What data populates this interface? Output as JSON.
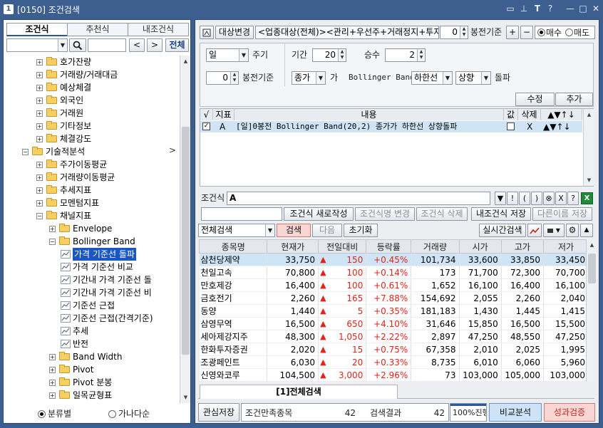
{
  "window": {
    "badge": "1",
    "title": "[0150] 조건검색"
  },
  "left": {
    "tabs": [
      "조건식",
      "추천식",
      "내조건식"
    ],
    "search": {
      "nav_prev": "<",
      "nav_next": ">",
      "all_button": "전체"
    },
    "tree": [
      {
        "label": "호가잔량",
        "level": 1,
        "toggle": "+"
      },
      {
        "label": "거래량/거래대금",
        "level": 1,
        "toggle": "+"
      },
      {
        "label": "예상체결",
        "level": 1,
        "toggle": "+"
      },
      {
        "label": "외국인",
        "level": 1,
        "toggle": "+"
      },
      {
        "label": "거래원",
        "level": 1,
        "toggle": "+"
      },
      {
        "label": "기타정보",
        "level": 1,
        "toggle": "+"
      },
      {
        "label": "체결강도",
        "level": 1,
        "toggle": "+"
      },
      {
        "label": "기술적분석",
        "level": 0,
        "toggle": "−"
      },
      {
        "label": "주가이동평균",
        "level": 1,
        "toggle": "+"
      },
      {
        "label": "거래량이동평균",
        "level": 1,
        "toggle": "+"
      },
      {
        "label": "추세지표",
        "level": 1,
        "toggle": "+"
      },
      {
        "label": "모멘텀지표",
        "level": 1,
        "toggle": "+"
      },
      {
        "label": "채널지표",
        "level": 1,
        "toggle": "−"
      },
      {
        "label": "Envelope",
        "level": 2,
        "toggle": "+"
      },
      {
        "label": "Bollinger Band",
        "level": 2,
        "toggle": "−"
      },
      {
        "label": "가격 기준선 돌파",
        "level": 3,
        "leaf": true,
        "selected": true
      },
      {
        "label": "가격 기준선 비교",
        "level": 3,
        "leaf": true
      },
      {
        "label": "기간내 가격 기준선 돌",
        "level": 3,
        "leaf": true
      },
      {
        "label": "기간내 가격 기준선 비",
        "level": 3,
        "leaf": true
      },
      {
        "label": "기준선 근접",
        "level": 3,
        "leaf": true
      },
      {
        "label": "기준선 근접(간격기준)",
        "level": 3,
        "leaf": true
      },
      {
        "label": "추세",
        "level": 3,
        "leaf": true
      },
      {
        "label": "반전",
        "level": 3,
        "leaf": true
      },
      {
        "label": "Band Width",
        "level": 2,
        "toggle": "+"
      },
      {
        "label": "Pivot",
        "level": 2,
        "toggle": "+"
      },
      {
        "label": "Pivot 분봉",
        "level": 2,
        "toggle": "+"
      },
      {
        "label": "일목균형표",
        "level": 2,
        "toggle": "+"
      }
    ],
    "tree_expander_arrow": ">",
    "radios": {
      "by_category": "분류별",
      "alphabetical": "가나다순"
    }
  },
  "right": {
    "target_button": "대상변경",
    "universe_text": "<업종대상(전체)><관리+우선주+거래정지+투자",
    "bar_offset": "0",
    "bar_basis_label": "봉전기준",
    "plus": "+",
    "minus": "−",
    "buy_label": "매수",
    "sell_label": "매도",
    "params": {
      "period_type": "일",
      "period_type_label": "주기",
      "range_label": "기간",
      "range_value": "20",
      "mult_label": "승수",
      "mult_value": "2",
      "bar_offset": "0",
      "bar_basis_label": "봉전기준",
      "price_field": "종가",
      "particle": "가",
      "indicator_label": "Bollinger Band",
      "line": "하한선",
      "direction": "상향",
      "action": "돌파"
    },
    "edit_button": "수정",
    "add_button": "추가",
    "cond_table": {
      "headers": [
        "√",
        "지표",
        "내용",
        "값",
        "삭제",
        "▲▼↑↓"
      ],
      "rows": [
        {
          "checked": true,
          "id": "A",
          "content": "[일]0봉전 Bollinger Band(20,2) 종가가 하한선 상향돌파",
          "delete": "X",
          "arrows": "▲▼↑↓"
        }
      ]
    },
    "formula": {
      "label": "조건식",
      "value": "A",
      "buttons": [
        "▼",
        "!",
        "(",
        ")",
        "⊗",
        "X",
        "?"
      ]
    },
    "actions": {
      "new_button": "조건식 새로작성",
      "rename_button": "조건식명 변경",
      "delete_button": "조건식 삭제",
      "save_button": "내조건식 저장",
      "save_as_button": "다른이름 저장"
    },
    "searchbar": {
      "scope": "전체검색",
      "search_button": "검색",
      "next_button": "다음",
      "reset_button": "초기화",
      "realtime_button": "실시간검색"
    },
    "grid": {
      "headers": [
        "종목명",
        "현재가",
        "전일대비",
        "등락률",
        "거래량",
        "시가",
        "고가",
        "저가"
      ],
      "rows": [
        {
          "name": "삼천당제약",
          "price": "33,750",
          "change": "150",
          "rate": "+0.45%",
          "volume": "101,734",
          "open": "33,600",
          "high": "33,850",
          "low": "33,450",
          "highlight": true
        },
        {
          "name": "천일고속",
          "price": "70,800",
          "change": "100",
          "rate": "+0.14%",
          "volume": "173",
          "open": "71,700",
          "high": "72,300",
          "low": "70,700"
        },
        {
          "name": "만호제강",
          "price": "16,400",
          "change": "100",
          "rate": "+0.61%",
          "volume": "1,652",
          "open": "16,100",
          "high": "16,400",
          "low": "16,100"
        },
        {
          "name": "금호전기",
          "price": "2,260",
          "change": "165",
          "rate": "+7.88%",
          "volume": "154,692",
          "open": "2,055",
          "high": "2,260",
          "low": "2,040"
        },
        {
          "name": "동양",
          "price": "1,440",
          "change": "5",
          "rate": "+0.35%",
          "volume": "181,183",
          "open": "1,430",
          "high": "1,445",
          "low": "1,415"
        },
        {
          "name": "삼영무역",
          "price": "16,500",
          "change": "650",
          "rate": "+4.10%",
          "volume": "31,646",
          "open": "15,850",
          "high": "16,500",
          "low": "15,500"
        },
        {
          "name": "세아제강지주",
          "price": "48,300",
          "change": "1,050",
          "rate": "+2.22%",
          "volume": "2,897",
          "open": "47,250",
          "high": "48,550",
          "low": "47,250"
        },
        {
          "name": "한화투자증권",
          "price": "2,020",
          "change": "15",
          "rate": "+0.75%",
          "volume": "67,358",
          "open": "2,010",
          "high": "2,025",
          "low": "1,995"
        },
        {
          "name": "조광페인트",
          "price": "6,030",
          "change": "20",
          "rate": "+0.33%",
          "volume": "8,735",
          "open": "6,010",
          "high": "6,060",
          "low": "5,960"
        },
        {
          "name": "신영와코루",
          "price": "104,500",
          "change": "3,000",
          "rate": "+2.96%",
          "volume": "73",
          "open": "103,000",
          "high": "105,000",
          "low": "103,000"
        }
      ]
    },
    "result_tab": "[1]전체검색",
    "bottom": {
      "save_interest": "관심저장",
      "matched_label": "조건만족종목",
      "matched_count": "42",
      "result_label": "검색결과",
      "result_count": "42",
      "progress_text": "100%진행",
      "progress_fraction": 1.0,
      "compare_button": "비교분석",
      "perf_button": "성과검증"
    }
  },
  "colors": {
    "frame": "#3c5f8f",
    "selection": "#1b56c5",
    "up": "#e2231a",
    "row_highlight": "#cfe5f6"
  }
}
